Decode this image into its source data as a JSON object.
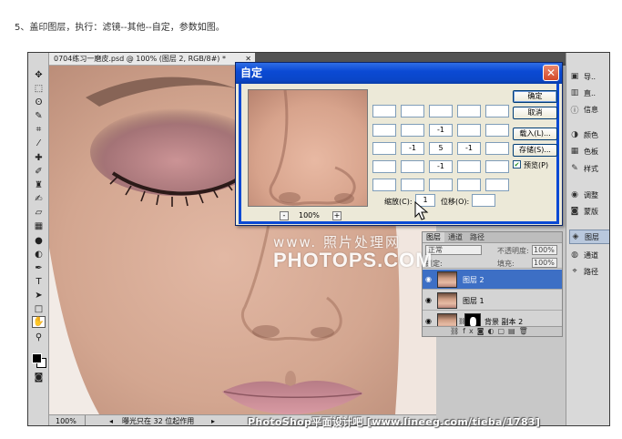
{
  "instruction": "5、盖印图层，执行：滤镜--其他--自定，参数如图。",
  "document": {
    "tab_title": "0704练习一磨皮.psd @ 100% (图层 2, RGB/8#) *",
    "zoom": "100%",
    "status_info": "曝光只在 32 位起作用"
  },
  "dock": {
    "items": [
      {
        "label": "导..",
        "icon": "navigator-icon"
      },
      {
        "label": "直..",
        "icon": "histogram-icon"
      },
      {
        "label": "信息",
        "icon": "info-icon"
      },
      {
        "label": "颜色",
        "icon": "color-icon"
      },
      {
        "label": "色板",
        "icon": "swatches-icon"
      },
      {
        "label": "样式",
        "icon": "styles-icon"
      },
      {
        "label": "调整",
        "icon": "adjustments-icon"
      },
      {
        "label": "蒙版",
        "icon": "masks-icon"
      },
      {
        "label": "图层",
        "icon": "layers-icon"
      },
      {
        "label": "通道",
        "icon": "channels-icon"
      },
      {
        "label": "路径",
        "icon": "paths-icon"
      }
    ]
  },
  "layers_panel": {
    "tabs": [
      "图层",
      "通道",
      "路径"
    ],
    "blend_mode": "正常",
    "opacity_label": "不透明度:",
    "opacity": "100%",
    "lock_label": "锁定:",
    "fill_label": "填充:",
    "fill": "100%",
    "layers": [
      {
        "name": "图层 2",
        "selected": true
      },
      {
        "name": "图层 1",
        "selected": false
      },
      {
        "name": "背景 副本 2",
        "selected": false
      }
    ]
  },
  "dialog": {
    "title": "自定",
    "close_label": "✕",
    "preview_zoom": "100%",
    "zoom_out": "-",
    "zoom_in": "+",
    "matrix": [
      [
        "",
        "",
        "",
        "",
        ""
      ],
      [
        "",
        "",
        "-1",
        "",
        ""
      ],
      [
        "",
        "-1",
        "5",
        "-1",
        ""
      ],
      [
        "",
        "",
        "-1",
        "",
        ""
      ],
      [
        "",
        "",
        "",
        "",
        ""
      ]
    ],
    "scale_label": "缩放(C):",
    "scale_value": "1",
    "offset_label": "位移(O):",
    "offset_value": "",
    "buttons": {
      "ok": "确定",
      "cancel": "取消",
      "load": "载入(L)...",
      "save": "存储(S)..."
    },
    "preview_checkbox": "预览(P)",
    "preview_checked": true
  },
  "watermark": {
    "line1": "www. 照片处理网",
    "line2": "PHOTOPS.COM"
  },
  "footer_mark": "PhotoShop平面设计吧 [www.lineeg.com/tieba/1783]"
}
